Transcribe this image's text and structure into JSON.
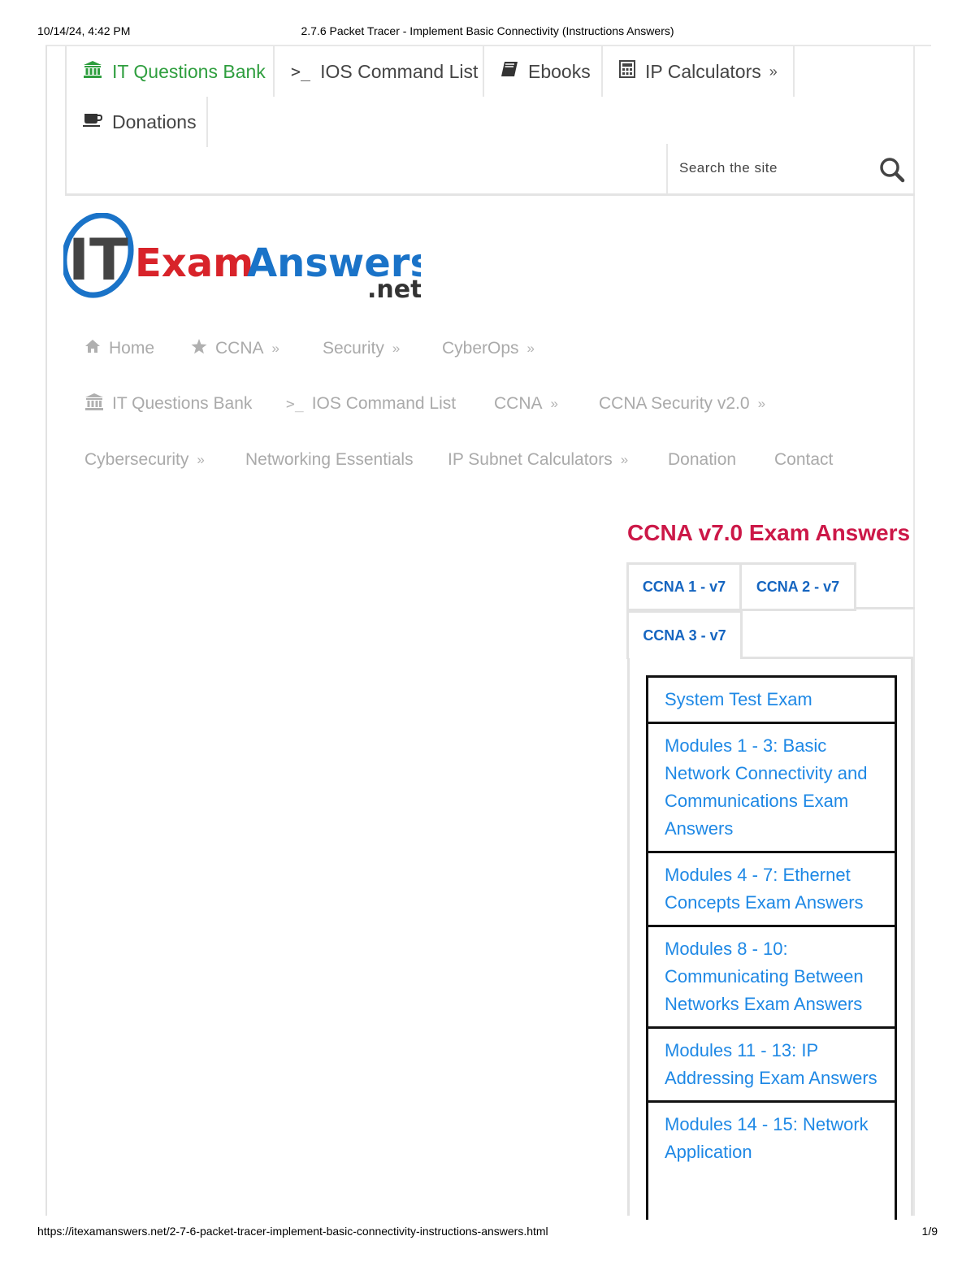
{
  "print_header": {
    "datetime": "10/14/24, 4:42 PM",
    "title": "2.7.6 Packet Tracer - Implement Basic Connectivity (Instructions Answers)"
  },
  "print_footer": {
    "url": "https://itexamanswers.net/2-7-6-packet-tracer-implement-basic-connectivity-instructions-answers.html",
    "page": "1/9"
  },
  "topbar": {
    "items": [
      {
        "label": "IT Questions Bank",
        "icon": "bank-icon"
      },
      {
        "label": "IOS Command List",
        "icon": "terminal-icon"
      },
      {
        "label": "Ebooks",
        "icon": "book-icon"
      },
      {
        "label": "IP Calculators",
        "icon": "calculator-icon",
        "more": "»"
      },
      {
        "label": "Donations",
        "icon": "coffee-icon"
      }
    ],
    "search_placeholder": "Search the site"
  },
  "logo": {
    "it": "IT",
    "exam": "Exam",
    "answers": "Answers",
    "tld": ".net"
  },
  "main_nav": {
    "items": [
      {
        "label": "Home",
        "icon": "home-icon"
      },
      {
        "label": "CCNA",
        "icon": "star-icon",
        "more": "»"
      },
      {
        "label": "Security",
        "more": "»"
      },
      {
        "label": "CyberOps",
        "more": "»"
      },
      {
        "label": "IT Questions Bank",
        "icon": "bank-icon"
      },
      {
        "label": "IOS Command List",
        "icon": "terminal-icon"
      },
      {
        "label": "CCNA",
        "more": "»"
      },
      {
        "label": "CCNA Security v2.0",
        "more": "»"
      },
      {
        "label": "Cybersecurity",
        "more": "»"
      },
      {
        "label": "Networking Essentials"
      },
      {
        "label": "IP Subnet Calculators",
        "more": "»"
      },
      {
        "label": "Donation"
      },
      {
        "label": "Contact"
      }
    ]
  },
  "sidebar": {
    "title": "CCNA v7.0 Exam Answers",
    "tabs": [
      "CCNA 1 - v7",
      "CCNA 2 - v7",
      "CCNA 3 - v7"
    ],
    "active_tab": "CCNA 3 - v7",
    "links": [
      "System Test Exam",
      "Modules 1 - 3: Basic Network Connectivity and Communications Exam Answers",
      "Modules 4 - 7: Ethernet Concepts Exam Answers",
      "Modules 8 - 10: Communicating Between Networks Exam Answers",
      "Modules 11 - 13: IP Addressing Exam Answers",
      "Modules 14 - 15: Network Application"
    ]
  },
  "colors": {
    "accent_green": "#2e9e3e",
    "widget_title": "#cc1848",
    "link_blue": "#1e88e5",
    "tab_blue": "#1565c0",
    "logo_red": "#d8232a",
    "logo_blue": "#1a73c8"
  }
}
